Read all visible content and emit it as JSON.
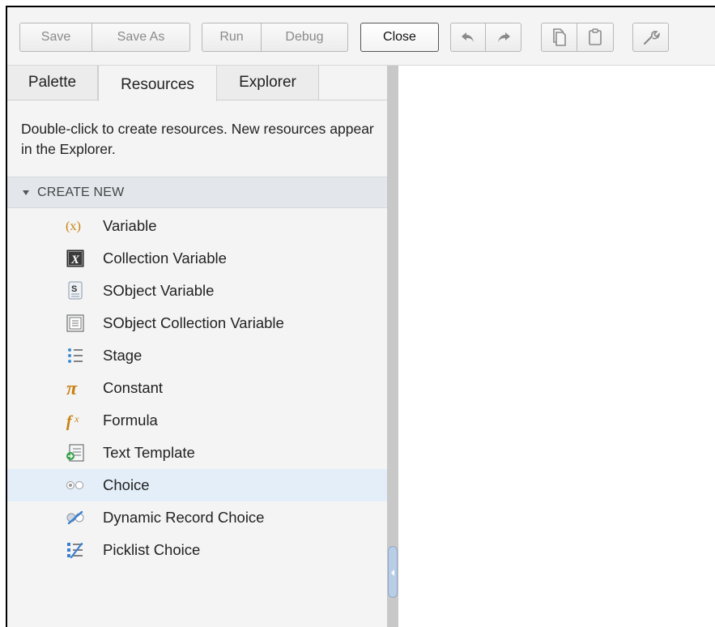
{
  "toolbar": {
    "save_label": "Save",
    "save_as_label": "Save As",
    "run_label": "Run",
    "debug_label": "Debug",
    "close_label": "Close",
    "icons": [
      "undo-icon",
      "redo-icon",
      "copy-icon",
      "paste-icon",
      "wrench-icon"
    ]
  },
  "tabs": [
    {
      "label": "Palette",
      "selected": false
    },
    {
      "label": "Resources",
      "selected": true
    },
    {
      "label": "Explorer",
      "selected": false
    }
  ],
  "resources": {
    "description": "Double-click to create resources. New resources appear in the Explorer.",
    "section_label": "CREATE NEW",
    "items": [
      {
        "label": "Variable",
        "icon": "variable-icon",
        "highlighted": false
      },
      {
        "label": "Collection Variable",
        "icon": "collection-variable-icon",
        "highlighted": false
      },
      {
        "label": "SObject Variable",
        "icon": "sobject-variable-icon",
        "highlighted": false
      },
      {
        "label": "SObject Collection Variable",
        "icon": "sobject-collection-variable-icon",
        "highlighted": false
      },
      {
        "label": "Stage",
        "icon": "stage-icon",
        "highlighted": false
      },
      {
        "label": "Constant",
        "icon": "constant-icon",
        "highlighted": false
      },
      {
        "label": "Formula",
        "icon": "formula-icon",
        "highlighted": false
      },
      {
        "label": "Text Template",
        "icon": "text-template-icon",
        "highlighted": false
      },
      {
        "label": "Choice",
        "icon": "choice-icon",
        "highlighted": true
      },
      {
        "label": "Dynamic Record Choice",
        "icon": "dynamic-record-choice-icon",
        "highlighted": false
      },
      {
        "label": "Picklist Choice",
        "icon": "picklist-choice-icon",
        "highlighted": false
      }
    ]
  },
  "colors": {
    "panel_bg": "#f4f4f4",
    "section_bg": "#e3e7eb",
    "highlight_bg": "#e3eef9",
    "formula_orange": "#c8800f"
  }
}
